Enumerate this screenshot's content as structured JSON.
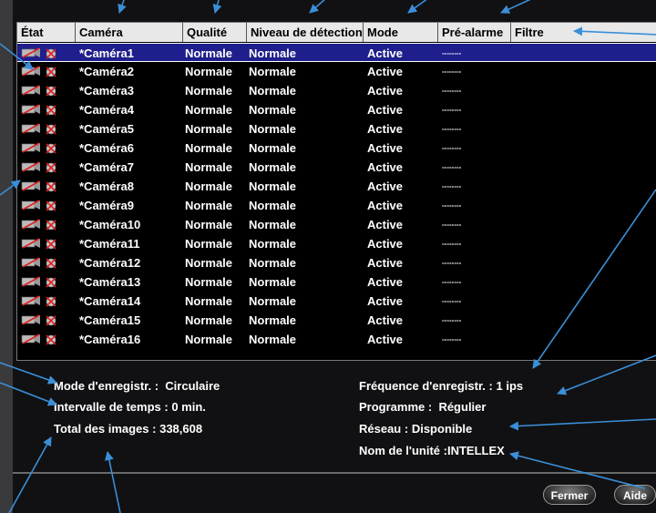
{
  "columns": [
    "État",
    "Caméra",
    "Qualité",
    "Niveau de détection",
    "Mode",
    "Pré-alarme",
    "Filtre"
  ],
  "rows": [
    {
      "camera": "*Caméra1",
      "quality": "Normale",
      "detection": "Normale",
      "mode": "Active",
      "prealarm": "--------"
    },
    {
      "camera": "*Caméra2",
      "quality": "Normale",
      "detection": "Normale",
      "mode": "Active",
      "prealarm": "--------"
    },
    {
      "camera": "*Caméra3",
      "quality": "Normale",
      "detection": "Normale",
      "mode": "Active",
      "prealarm": "--------"
    },
    {
      "camera": "*Caméra4",
      "quality": "Normale",
      "detection": "Normale",
      "mode": "Active",
      "prealarm": "--------"
    },
    {
      "camera": "*Caméra5",
      "quality": "Normale",
      "detection": "Normale",
      "mode": "Active",
      "prealarm": "--------"
    },
    {
      "camera": "*Caméra6",
      "quality": "Normale",
      "detection": "Normale",
      "mode": "Active",
      "prealarm": "--------"
    },
    {
      "camera": "*Caméra7",
      "quality": "Normale",
      "detection": "Normale",
      "mode": "Active",
      "prealarm": "--------"
    },
    {
      "camera": "*Caméra8",
      "quality": "Normale",
      "detection": "Normale",
      "mode": "Active",
      "prealarm": "--------"
    },
    {
      "camera": "*Caméra9",
      "quality": "Normale",
      "detection": "Normale",
      "mode": "Active",
      "prealarm": "--------"
    },
    {
      "camera": "*Caméra10",
      "quality": "Normale",
      "detection": "Normale",
      "mode": "Active",
      "prealarm": "--------"
    },
    {
      "camera": "*Caméra11",
      "quality": "Normale",
      "detection": "Normale",
      "mode": "Active",
      "prealarm": "--------"
    },
    {
      "camera": "*Caméra12",
      "quality": "Normale",
      "detection": "Normale",
      "mode": "Active",
      "prealarm": "--------"
    },
    {
      "camera": "*Caméra13",
      "quality": "Normale",
      "detection": "Normale",
      "mode": "Active",
      "prealarm": "--------"
    },
    {
      "camera": "*Caméra14",
      "quality": "Normale",
      "detection": "Normale",
      "mode": "Active",
      "prealarm": "--------"
    },
    {
      "camera": "*Caméra15",
      "quality": "Normale",
      "detection": "Normale",
      "mode": "Active",
      "prealarm": "--------"
    },
    {
      "camera": "*Caméra16",
      "quality": "Normale",
      "detection": "Normale",
      "mode": "Active",
      "prealarm": "--------"
    }
  ],
  "selected_row": 0,
  "info_left": {
    "mode_label": "Mode d'enregistr. :",
    "mode_value": "Circulaire",
    "interval_label": "Intervalle de temps :",
    "interval_value": "0 min.",
    "total_label": "Total des images :",
    "total_value": "338,608"
  },
  "info_right": {
    "freq_label": "Fréquence d'enregistr. :",
    "freq_value": "1 ips",
    "program_label": "Programme :",
    "program_value": "Régulier",
    "network_label": "Réseau :",
    "network_value": "Disponible",
    "unit_label": "Nom de l'unité :",
    "unit_value": "INTELLEX"
  },
  "buttons": {
    "close": "Fermer",
    "help": "Aide"
  },
  "colors": {
    "selection": "#1e1e8c",
    "arrow": "#3a8fd8",
    "header_bg": "#e8e8e8"
  },
  "icons": [
    "camera-icon",
    "alarm-icon"
  ]
}
